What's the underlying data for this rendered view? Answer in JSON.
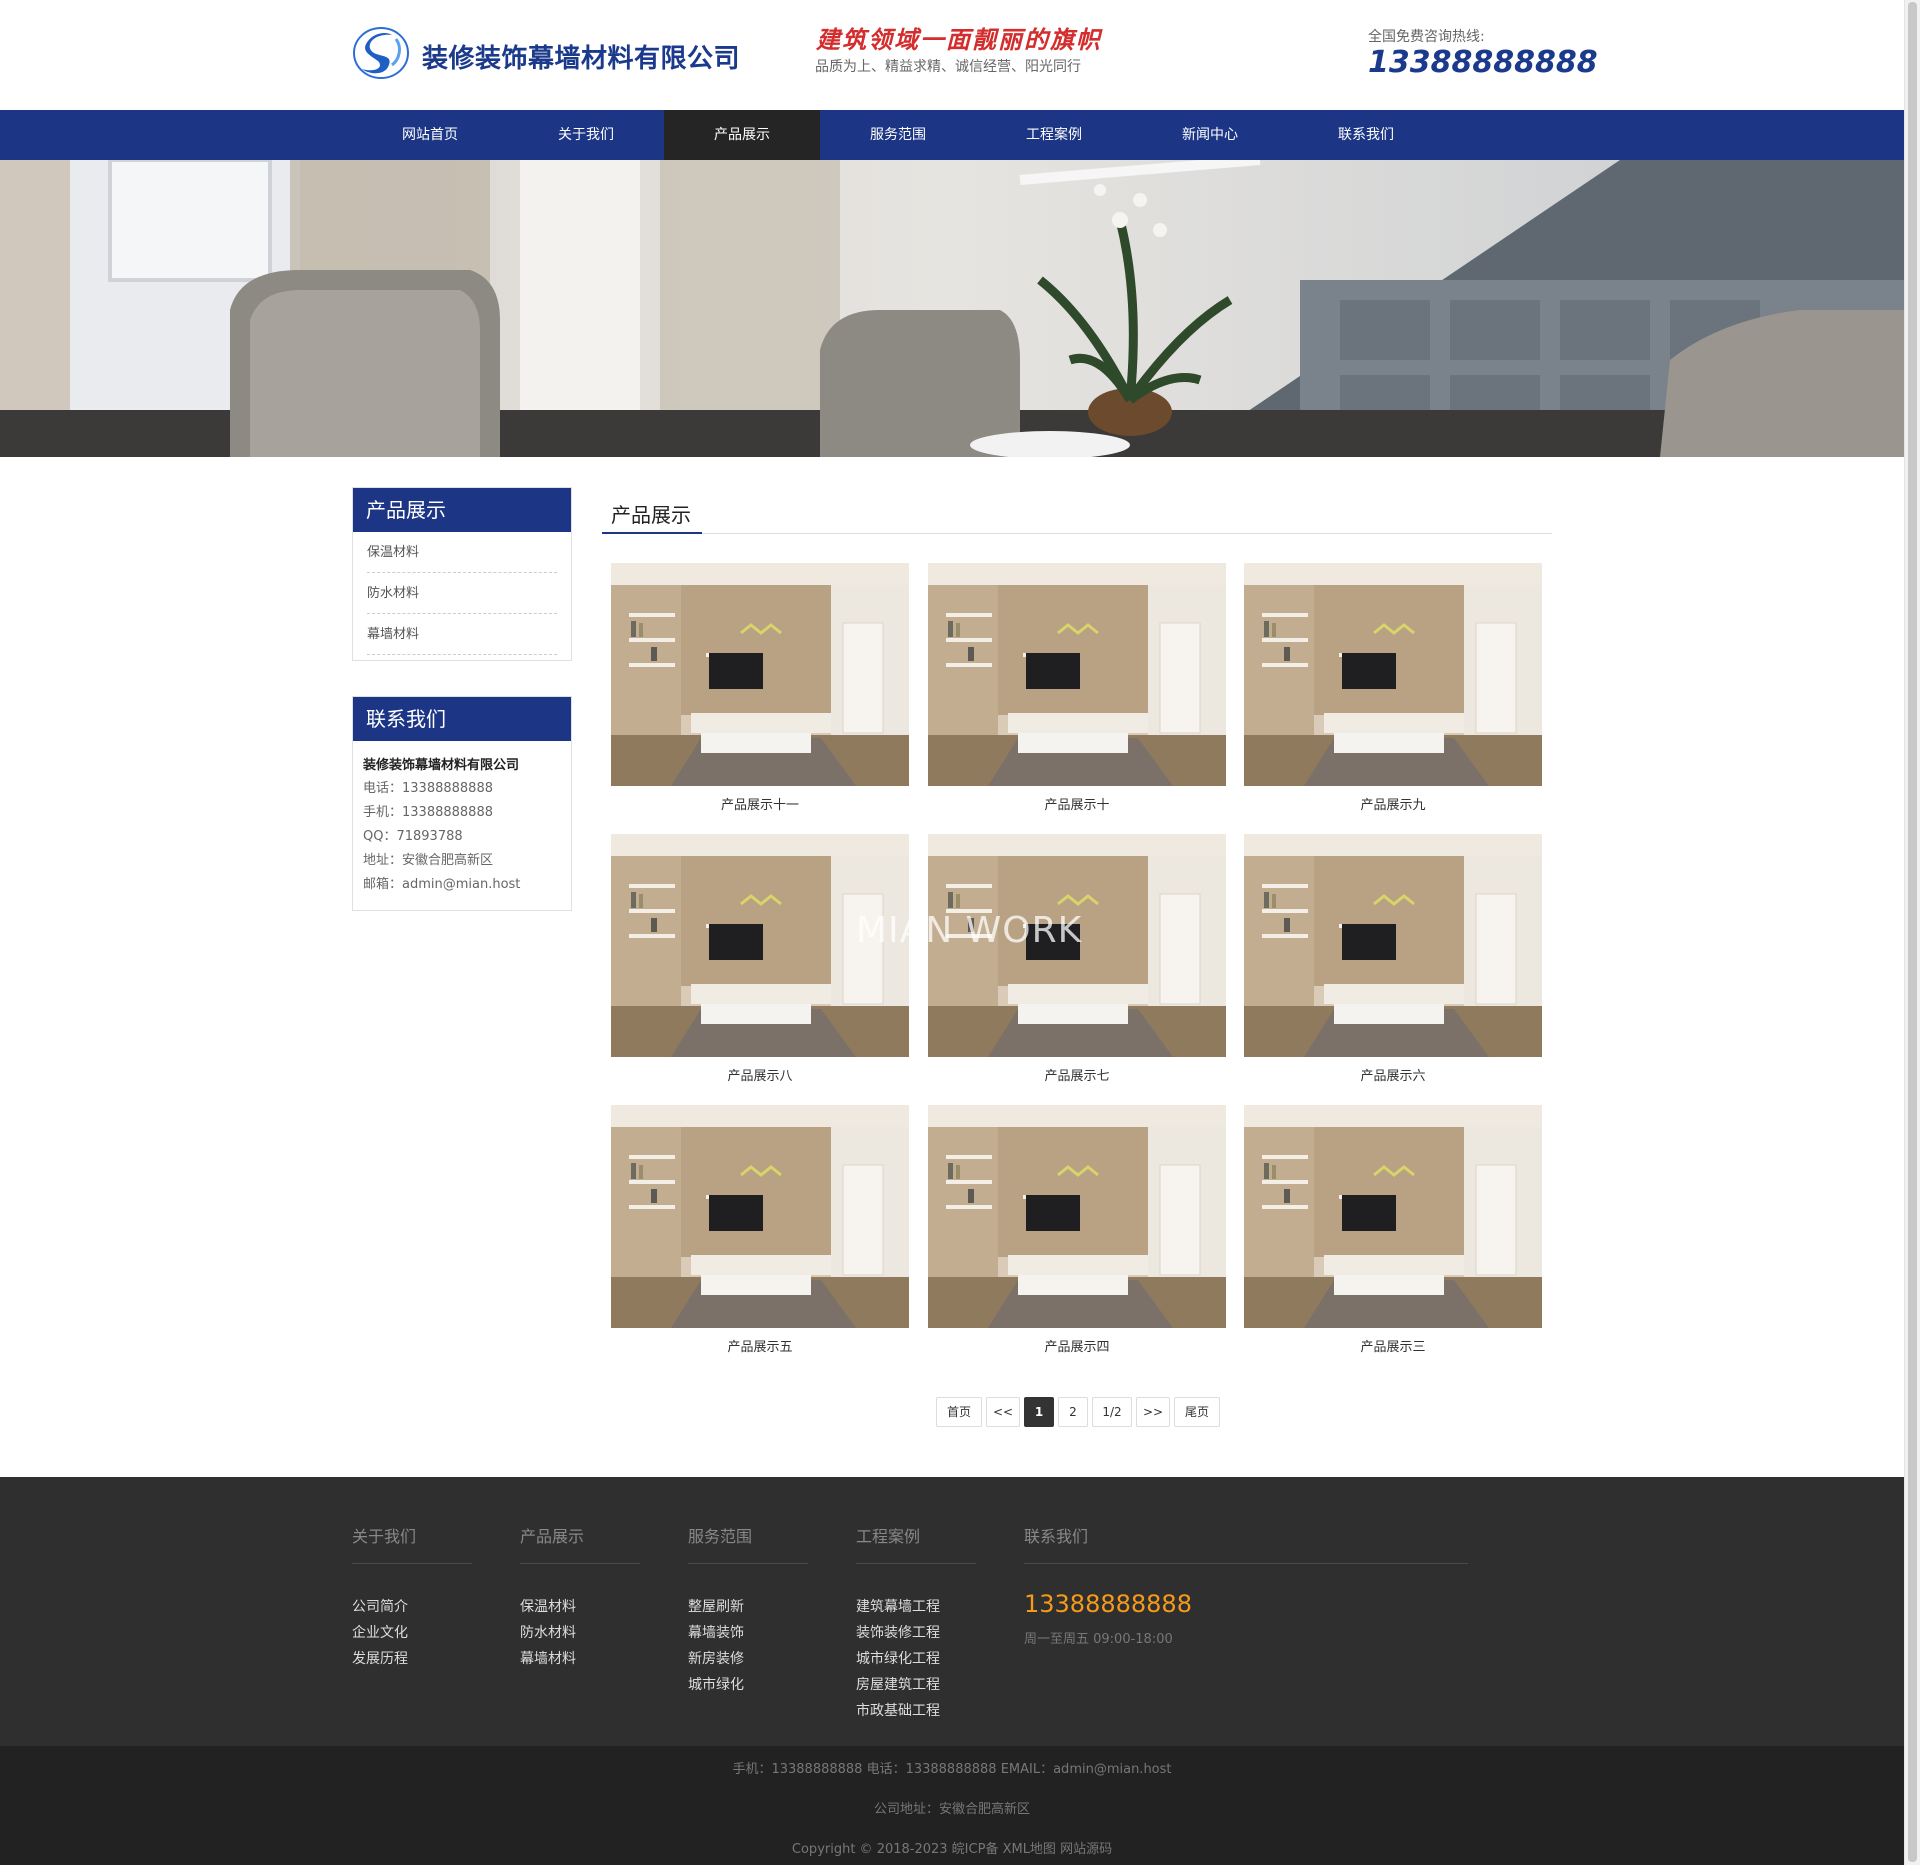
{
  "header": {
    "company_name": "装修装饰幕墙材料有限公司",
    "slogan": "建筑领域一面靓丽的旗帜",
    "slogan_sub": "品质为上、精益求精、诚信经营、阳光同行",
    "hotline_label": "全国免费咨询热线:",
    "hotline": "13388888888",
    "logo_icon": "swirl-logo-icon"
  },
  "nav": {
    "items": [
      "网站首页",
      "关于我们",
      "产品展示",
      "服务范围",
      "工程案例",
      "新闻中心",
      "联系我们"
    ],
    "active": "产品展示"
  },
  "sidebar": {
    "products_title": "产品展示",
    "products": [
      "保温材料",
      "防水材料",
      "幕墙材料"
    ],
    "contact_title": "联系我们",
    "contact_company": "装修装饰幕墙材料有限公司",
    "contact_lines": [
      "电话：13388888888",
      "手机：13388888888",
      "QQ：71893788",
      "地址：安徽合肥高新区",
      "邮箱：admin@mian.host"
    ]
  },
  "main": {
    "title": "产品展示",
    "products": [
      "产品展示十一",
      "产品展示十",
      "产品展示九",
      "产品展示八",
      "产品展示七",
      "产品展示六",
      "产品展示五",
      "产品展示四",
      "产品展示三"
    ],
    "watermark": "MIAN WORK"
  },
  "pagination": {
    "first": "首页",
    "prev": "<<",
    "pages": [
      "1",
      "2"
    ],
    "current": "1",
    "info": "1/2",
    "next": ">>",
    "last": "尾页"
  },
  "footer": {
    "columns": [
      {
        "title": "关于我们",
        "links": [
          "公司简介",
          "企业文化",
          "发展历程"
        ]
      },
      {
        "title": "产品展示",
        "links": [
          "保温材料",
          "防水材料",
          "幕墙材料"
        ]
      },
      {
        "title": "服务范围",
        "links": [
          "整屋刷新",
          "幕墙装饰",
          "新房装修",
          "城市绿化"
        ]
      },
      {
        "title": "工程案例",
        "links": [
          "建筑幕墙工程",
          "装饰装修工程",
          "城市绿化工程",
          "房屋建筑工程",
          "市政基础工程"
        ]
      }
    ],
    "contact_title": "联系我们",
    "contact_phone": "13388888888",
    "contact_hours": "周一至周五 09:00-18:00",
    "bottom_line1": "手机：13388888888  电话：13388888888  EMAIL：admin@mian.host",
    "bottom_line2": "公司地址：安徽合肥高新区",
    "bottom_line3": "Copyright © 2018-2023  皖ICP备 XML地图 网站源码"
  },
  "colors": {
    "brand_blue": "#1c3685",
    "nav_active": "#252525",
    "slogan_red": "#d42d2d",
    "footer_phone": "#f59a1a"
  }
}
